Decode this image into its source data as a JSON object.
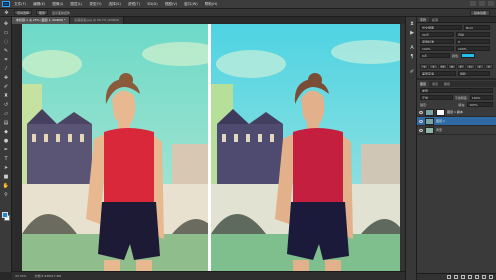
{
  "app": {
    "logo": "Ps"
  },
  "menu": [
    "文件(F)",
    "编辑(E)",
    "图像(I)",
    "图层(L)",
    "类型(Y)",
    "选择(S)",
    "滤镜(T)",
    "3D(D)",
    "视图(V)",
    "窗口(W)",
    "帮助(H)"
  ],
  "options": {
    "items": [
      "自动选择",
      "图层",
      "显示变换控件"
    ],
    "workspace": "基本功能"
  },
  "tabs": [
    {
      "label": "未标题-1 @ 25% (图层 1, RGB/8) *",
      "active": true
    },
    {
      "label": "欧美街拍.jpg @ 66.7% (RGB/8)",
      "active": false
    }
  ],
  "status": {
    "zoom": "33.33%",
    "doc": "文档:5.93M/17.9M"
  },
  "character": {
    "font": "华文细黑",
    "style": "Bold",
    "size": "20点",
    "leading": "自动",
    "tracking": "0",
    "kerning": "度量标准",
    "vscale": "100%",
    "hscale": "100%",
    "baseline": "0点",
    "color_label": "颜色:",
    "text_color": "#1ec0f0",
    "styles": [
      "T",
      "T",
      "TT",
      "Tt",
      "T¹",
      "T₁",
      "T",
      "T"
    ],
    "language": "美国英语",
    "aa": "锐利"
  },
  "panels": {
    "character_tabs": [
      "字符",
      "段落"
    ],
    "layers_tabs": [
      "图层",
      "通道",
      "路径"
    ]
  },
  "layers": {
    "kind_filter": "类型",
    "blend_mode": "正常",
    "opacity_label": "不透明度:",
    "opacity": "100%",
    "lock_label": "锁定:",
    "fill_label": "填充:",
    "fill": "100%",
    "rows": [
      {
        "name": "图层 1 副本",
        "selected": false
      },
      {
        "name": "图层 1",
        "selected": true
      },
      {
        "name": "背景",
        "selected": false
      }
    ]
  },
  "tool_icons": [
    "move-icon",
    "marquee-icon",
    "lasso-icon",
    "quick-select-icon",
    "crop-icon",
    "eyedropper-icon",
    "healing-icon",
    "brush-icon",
    "stamp-icon",
    "history-brush-icon",
    "eraser-icon",
    "gradient-icon",
    "blur-icon",
    "dodge-icon",
    "pen-icon",
    "type-icon",
    "path-select-icon",
    "shape-icon",
    "hand-icon",
    "zoom-icon"
  ],
  "colors": {
    "foreground": "#1b8cd0",
    "background": "#ffffff",
    "selection": "#2f6aa5"
  }
}
